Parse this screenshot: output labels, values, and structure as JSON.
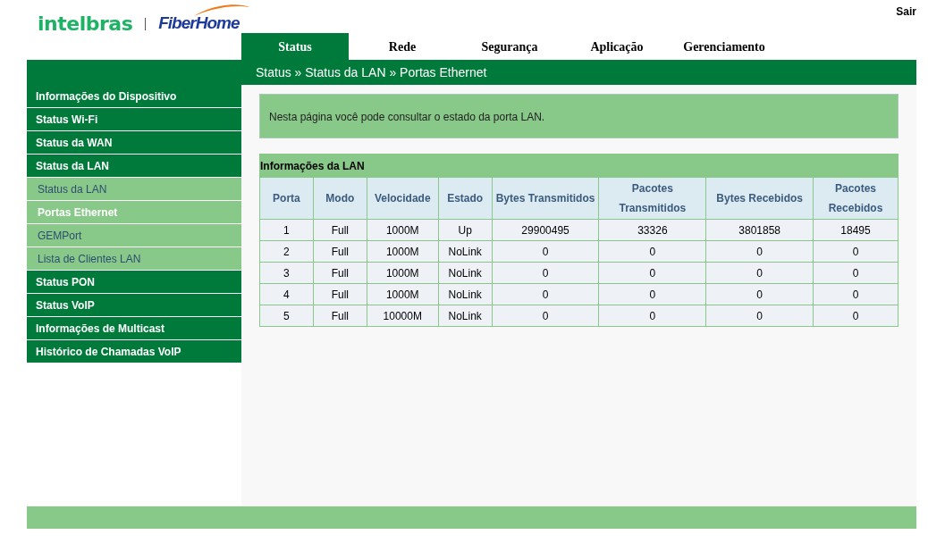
{
  "logo": {
    "brand": "intelbras",
    "partner": "FiberHome"
  },
  "logout": "Sair",
  "tabs": [
    {
      "label": "Status",
      "selected": true
    },
    {
      "label": "Rede",
      "selected": false
    },
    {
      "label": "Segurança",
      "selected": false
    },
    {
      "label": "Aplicação",
      "selected": false
    },
    {
      "label": "Gerenciamento",
      "selected": false
    }
  ],
  "breadcrumb": "Status » Status da LAN » Portas Ethernet",
  "sidebar": {
    "items": [
      {
        "label": "Informações do Dispositivo",
        "kind": "group",
        "selected": false
      },
      {
        "label": "Status Wi-Fi",
        "kind": "group",
        "selected": false
      },
      {
        "label": "Status da WAN",
        "kind": "group",
        "selected": false
      },
      {
        "label": "Status da LAN",
        "kind": "group",
        "selected": false
      },
      {
        "label": "Status da LAN",
        "kind": "sub",
        "selected": false
      },
      {
        "label": "Portas Ethernet",
        "kind": "sub",
        "selected": true
      },
      {
        "label": "GEMPort",
        "kind": "sub",
        "selected": false
      },
      {
        "label": "Lista de Clientes LAN",
        "kind": "sub",
        "selected": false
      },
      {
        "label": "Status PON",
        "kind": "group",
        "selected": false
      },
      {
        "label": "Status VoIP",
        "kind": "group",
        "selected": false
      },
      {
        "label": "Informações de Multicast",
        "kind": "group",
        "selected": false
      },
      {
        "label": "Histórico de Chamadas VoIP",
        "kind": "group",
        "selected": false
      }
    ]
  },
  "info": "Nesta página você pode consultar o estado da porta LAN.",
  "table": {
    "title": "Informações da LAN",
    "columns": [
      "Porta",
      "Modo",
      "Velocidade",
      "Estado",
      "Bytes Transmitidos",
      "Pacotes Transmitidos",
      "Bytes Recebidos",
      "Pacotes Recebidos"
    ],
    "rows": [
      [
        "1",
        "Full",
        "1000M",
        "Up",
        "29900495",
        "33326",
        "3801858",
        "18495"
      ],
      [
        "2",
        "Full",
        "1000M",
        "NoLink",
        "0",
        "0",
        "0",
        "0"
      ],
      [
        "3",
        "Full",
        "1000M",
        "NoLink",
        "0",
        "0",
        "0",
        "0"
      ],
      [
        "4",
        "Full",
        "1000M",
        "NoLink",
        "0",
        "0",
        "0",
        "0"
      ],
      [
        "5",
        "Full",
        "10000M",
        "NoLink",
        "0",
        "0",
        "0",
        "0"
      ]
    ]
  }
}
